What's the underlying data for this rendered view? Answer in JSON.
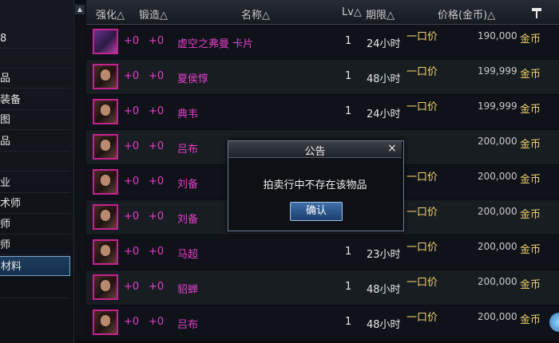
{
  "sidebar": {
    "items": [
      {
        "label": "8",
        "selected": false
      },
      {
        "label": "",
        "selected": false
      },
      {
        "label": "品",
        "selected": false
      },
      {
        "label": "装备",
        "selected": false
      },
      {
        "label": "图",
        "selected": false
      },
      {
        "label": "品",
        "selected": false
      },
      {
        "label": "",
        "selected": false
      },
      {
        "label": "业",
        "selected": false
      },
      {
        "label": "术师",
        "selected": false
      },
      {
        "label": "师",
        "selected": false
      },
      {
        "label": "师",
        "selected": false
      },
      {
        "label": "材料",
        "selected": true
      },
      {
        "label": "",
        "selected": false
      }
    ]
  },
  "table": {
    "headers": {
      "enhance": "强化△",
      "forge": "锻造△",
      "name": "名称△",
      "level": "Lv△",
      "period": "期限△",
      "price": "价格(金币)△"
    },
    "rows": [
      {
        "enhance": "+0",
        "forge": "+0",
        "name": "虚空之弗曼 卡片",
        "level": "1",
        "period": "24小时",
        "price_type": "一口价",
        "price": "190,000",
        "currency": "金币",
        "card": true
      },
      {
        "enhance": "+0",
        "forge": "+0",
        "name": "夏侯惇",
        "level": "1",
        "period": "48小时",
        "price_type": "一口价",
        "price": "199,999",
        "currency": "金币",
        "card": false
      },
      {
        "enhance": "+0",
        "forge": "+0",
        "name": "典韦",
        "level": "1",
        "period": "24小时",
        "price_type": "一口价",
        "price": "199,999",
        "currency": "金币",
        "card": false
      },
      {
        "enhance": "+0",
        "forge": "+0",
        "name": "吕布",
        "level": "",
        "period": "",
        "price_type": "",
        "price": "200,000",
        "currency": "金币",
        "card": false
      },
      {
        "enhance": "+0",
        "forge": "+0",
        "name": "刘备",
        "level": "",
        "period": "",
        "price_type": "一口价",
        "price": "200,000",
        "currency": "金币",
        "card": false
      },
      {
        "enhance": "+0",
        "forge": "+0",
        "name": "刘备",
        "level": "",
        "period": "",
        "price_type": "一口价",
        "price": "200,000",
        "currency": "金币",
        "card": false
      },
      {
        "enhance": "+0",
        "forge": "+0",
        "name": "马超",
        "level": "1",
        "period": "23小时",
        "price_type": "一口价",
        "price": "200,000",
        "currency": "金币",
        "card": false
      },
      {
        "enhance": "+0",
        "forge": "+0",
        "name": "貂蝉",
        "level": "1",
        "period": "48小时",
        "price_type": "一口价",
        "price": "200,000",
        "currency": "金币",
        "card": false
      },
      {
        "enhance": "+0",
        "forge": "+0",
        "name": "吕布",
        "level": "1",
        "period": "48小时",
        "price_type": "一口价",
        "price": "200,000",
        "currency": "金币",
        "card": false
      }
    ]
  },
  "dialog": {
    "title": "公告",
    "close_glyph": "×",
    "message": "拍卖行中不存在该物品",
    "confirm_label": "确认"
  },
  "icons": {
    "hammer": "hammer-icon",
    "scroll_up": "▲"
  },
  "colors": {
    "enhance_text": "#e23fc8",
    "name_text": "#e23fc8",
    "price_type_text": "#efd16a",
    "item_border": "#c7238f",
    "selected_category": "#1d3d5e"
  }
}
